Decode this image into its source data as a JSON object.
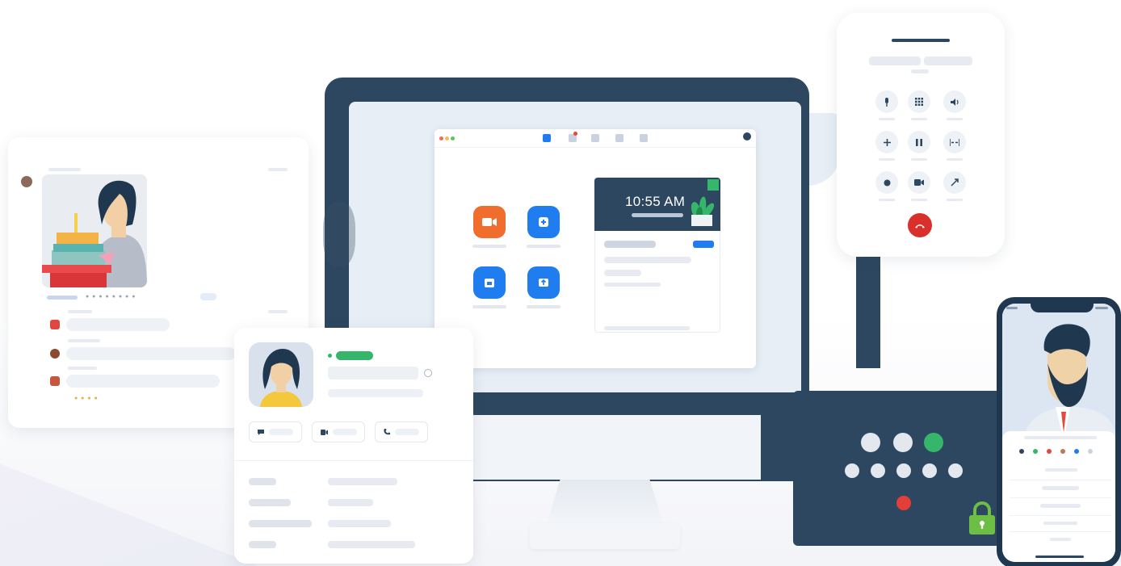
{
  "monitor": {
    "clock_time": "10:55 AM",
    "apps": [
      {
        "name": "new-meeting",
        "color": "#f06d2e"
      },
      {
        "name": "join",
        "color": "#1f7df0"
      },
      {
        "name": "schedule",
        "color": "#1f7df0"
      },
      {
        "name": "share-screen",
        "color": "#1f7df0"
      }
    ]
  },
  "colors": {
    "navy": "#2e4760",
    "zoom_blue": "#1f7df0",
    "orange": "#f06d2e",
    "green": "#35b66a",
    "red": "#d9302c"
  },
  "dialer": {
    "buttons": [
      "mute",
      "keypad",
      "audio",
      "add",
      "hold",
      "merge",
      "record",
      "video",
      "transfer"
    ],
    "hangup": "end-call"
  },
  "room_controller": {
    "lock": "locked"
  },
  "contact": {
    "status": "available"
  }
}
